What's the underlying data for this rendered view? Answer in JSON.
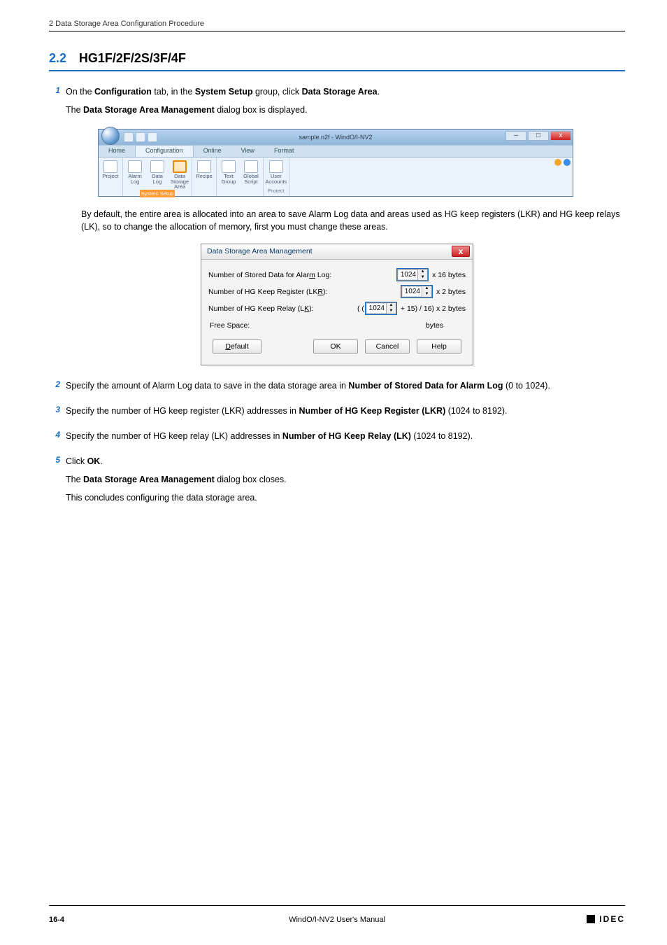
{
  "running_head": "2 Data Storage Area Configuration Procedure",
  "section": {
    "num": "2.2",
    "title": "HG1F/2F/2S/3F/4F"
  },
  "steps": [
    {
      "num": "1",
      "parts": [
        "On the ",
        "Configuration",
        " tab, in the ",
        "System Setup",
        " group, click ",
        "Data Storage Area",
        "."
      ],
      "after": [
        "The ",
        "Data Storage Area Management",
        " dialog box is displayed."
      ]
    },
    {
      "num": "2",
      "parts": [
        "Specify the amount of Alarm Log data to save in the data storage area in ",
        "Number of Stored Data for Alarm Log",
        " (0 to 1024)."
      ]
    },
    {
      "num": "3",
      "parts": [
        "Specify the number of HG keep register (LKR) addresses in ",
        "Number of HG Keep Register (LKR)",
        " (1024 to 8192)."
      ]
    },
    {
      "num": "4",
      "parts": [
        "Specify the number of HG keep relay (LK) addresses in ",
        "Number of HG Keep Relay (LK)",
        " (1024 to 8192)."
      ]
    },
    {
      "num": "5",
      "parts": [
        "Click ",
        "OK",
        "."
      ],
      "after_lines": [
        [
          "The ",
          "Data Storage Area Management",
          " dialog box closes."
        ],
        [
          "This concludes configuring the data storage area."
        ]
      ]
    }
  ],
  "mid_paragraph": "By default, the entire area is allocated into an area to save Alarm Log data and areas used as HG keep registers (LKR) and HG keep relays (LK), so to change the allocation of memory, first you must change these areas.",
  "ribbon": {
    "window_title": "sample.n2f - WindO/I-NV2",
    "tabs": [
      "Home",
      "Configuration",
      "Online",
      "View",
      "Format"
    ],
    "active_tab": "Configuration",
    "groups": [
      {
        "label": "",
        "items": [
          {
            "label": "Project"
          }
        ]
      },
      {
        "label": "System Setup",
        "hl": true,
        "items": [
          {
            "label": "Alarm Log"
          },
          {
            "label": "Data Log"
          },
          {
            "label": "Data Storage Area",
            "hl": true
          }
        ]
      },
      {
        "label": "",
        "items": [
          {
            "label": "Recipe"
          }
        ]
      },
      {
        "label": "",
        "items": [
          {
            "label": "Text Group"
          },
          {
            "label": "Global Script"
          }
        ]
      },
      {
        "label": "Protect",
        "items": [
          {
            "label": "User Accounts"
          }
        ]
      }
    ]
  },
  "dialog": {
    "title": "Data Storage Area Management",
    "rows": [
      {
        "label_parts": [
          "Number of Stored Data for Alar",
          "m",
          " Log:"
        ],
        "pre": "",
        "value": "1024",
        "suffix": "x 16 bytes"
      },
      {
        "label_parts": [
          "Number of HG Keep Register (LK",
          "R",
          "):"
        ],
        "pre": "",
        "value": "1024",
        "suffix": "x 2 bytes"
      },
      {
        "label_parts": [
          "Number of HG Keep Relay (L",
          "K",
          "):"
        ],
        "pre": "( (",
        "value": "1024",
        "suffix": "+ 15) / 16) x 2 bytes"
      }
    ],
    "free_label": "Free Space:",
    "free_unit": "bytes",
    "buttons": {
      "default_parts": [
        "D",
        "efault"
      ],
      "ok": "OK",
      "cancel": "Cancel",
      "help": "Help"
    }
  },
  "footer": {
    "page": "16-4",
    "manual": "WindO/I-NV2 User's Manual",
    "logo": "IDEC"
  }
}
